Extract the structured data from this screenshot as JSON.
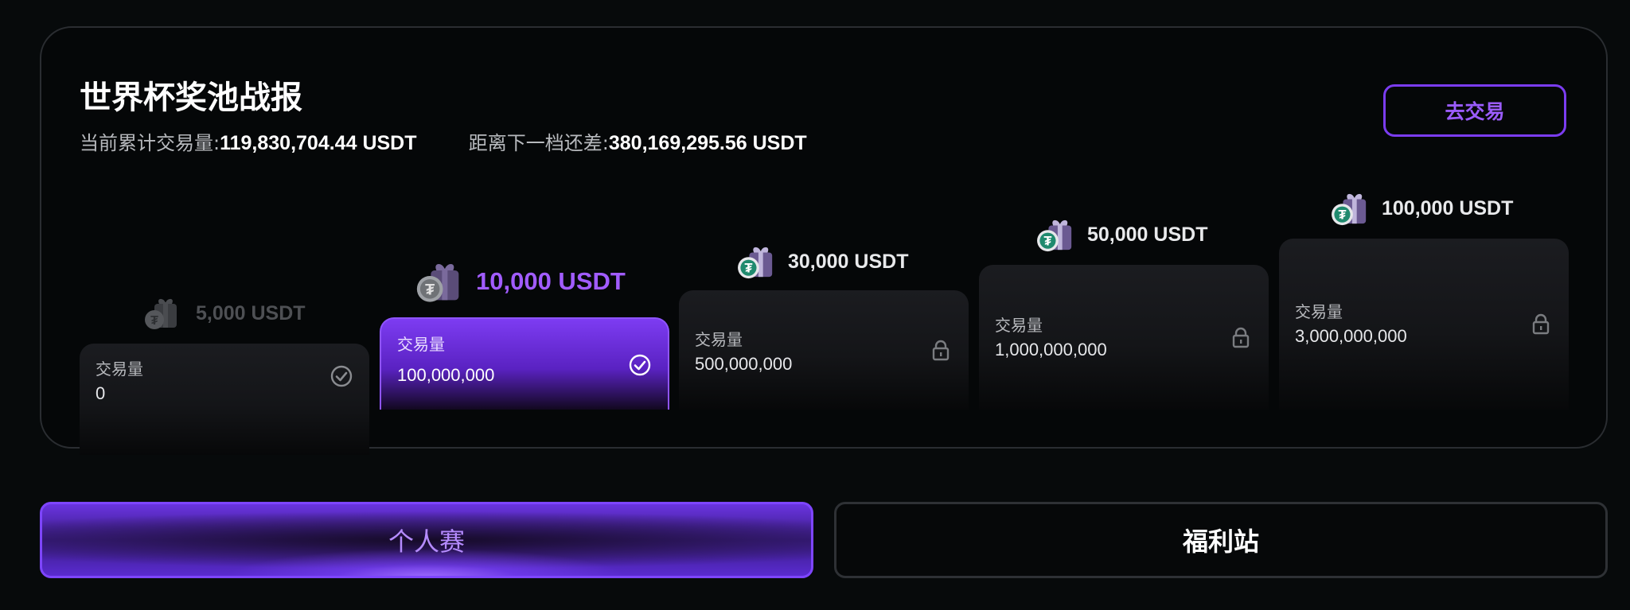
{
  "card": {
    "title": "世界杯奖池战报",
    "stats": {
      "current_label": "当前累计交易量:",
      "current_value": "119,830,704.44 USDT",
      "next_label": "距离下一档还差:",
      "next_value": "380,169,295.56 USDT"
    },
    "trade_button": "去交易"
  },
  "tiers": [
    {
      "reward": "5,000 USDT",
      "label": "交易量",
      "volume": "0",
      "status": "completed"
    },
    {
      "reward": "10,000 USDT",
      "label": "交易量",
      "volume": "100,000,000",
      "status": "current"
    },
    {
      "reward": "30,000 USDT",
      "label": "交易量",
      "volume": "500,000,000",
      "status": "locked"
    },
    {
      "reward": "50,000 USDT",
      "label": "交易量",
      "volume": "1,000,000,000",
      "status": "locked"
    },
    {
      "reward": "100,000 USDT",
      "label": "交易量",
      "volume": "3,000,000,000",
      "status": "locked"
    }
  ],
  "tabs": {
    "individual": "个人赛",
    "welfare": "福利站"
  },
  "icons": {
    "reward": "gift-coin-icon",
    "completed": "check-circle-icon",
    "locked": "lock-icon"
  },
  "colors": {
    "accent": "#7b3cf0",
    "accent_text": "#9b5cff",
    "background": "#070a0b"
  }
}
